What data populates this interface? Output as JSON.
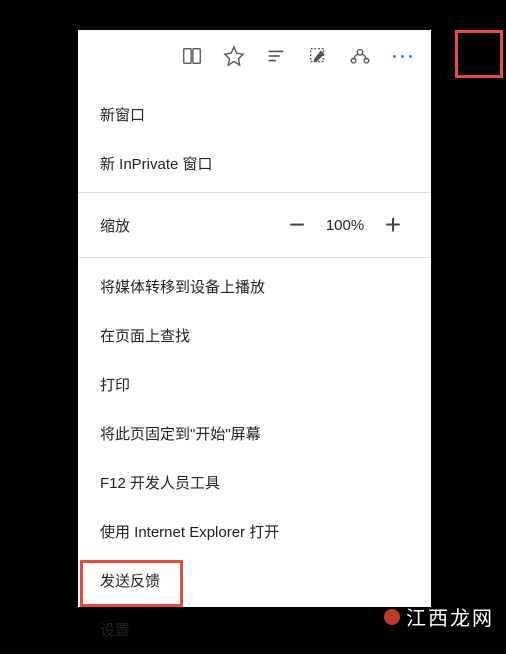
{
  "toolbar": {
    "icons": {
      "reading_list": "reading-list-icon",
      "favorites": "star-icon",
      "hub": "lines-icon",
      "web_note": "pen-icon",
      "share": "share-icon",
      "more": "more-icon"
    }
  },
  "menu": {
    "new_window": "新窗口",
    "new_inprivate": "新 InPrivate 窗口",
    "zoom": {
      "label": "缩放",
      "value": "100%",
      "minus": "−",
      "plus": "+"
    },
    "cast_media": "将媒体转移到设备上播放",
    "find_on_page": "在页面上查找",
    "print": "打印",
    "pin_to_start": "将此页固定到\"开始\"屏幕",
    "f12_devtools": "F12 开发人员工具",
    "open_with_ie": "使用 Internet Explorer 打开",
    "send_feedback": "发送反馈",
    "settings": "设置"
  },
  "watermark": "江西龙网"
}
